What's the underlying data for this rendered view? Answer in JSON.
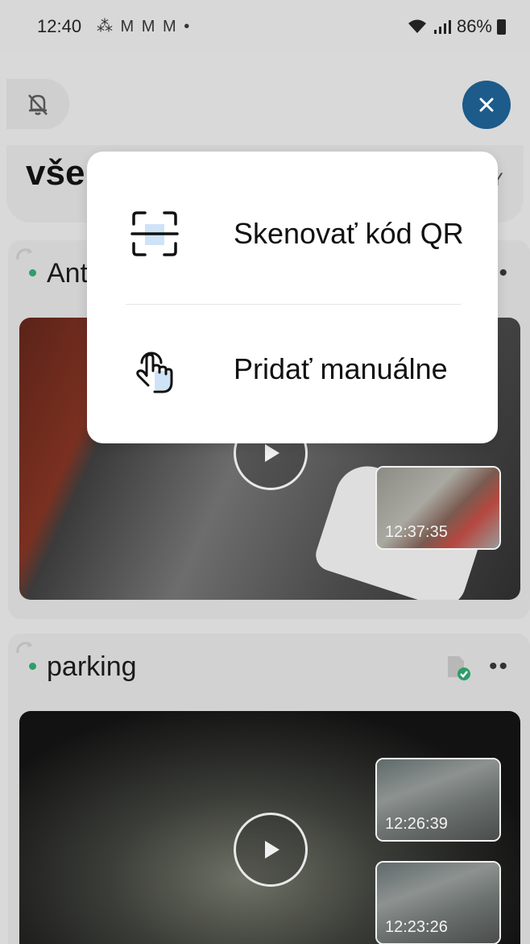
{
  "status_bar": {
    "time": "12:40",
    "notifications": "⁂ M M M •",
    "right": "86%"
  },
  "header": {
    "filter_text": "vše",
    "filter_trailing": "Y"
  },
  "cards": [
    {
      "name": "Ant",
      "thumbnails": [
        {
          "time": "12:37:35"
        }
      ]
    },
    {
      "name": "parking",
      "thumbnails": [
        {
          "time": "12:26:39"
        },
        {
          "time": "12:23:26"
        }
      ]
    }
  ],
  "popup": {
    "items": [
      {
        "label": "Skenovať kód QR",
        "icon": "qr-scan-icon"
      },
      {
        "label": "Pridať manuálne",
        "icon": "hand-touch-icon"
      }
    ]
  },
  "colors": {
    "accent": "#1c5b8a",
    "online": "#2f9d6a",
    "icon_highlight": "#cfe3f6"
  }
}
